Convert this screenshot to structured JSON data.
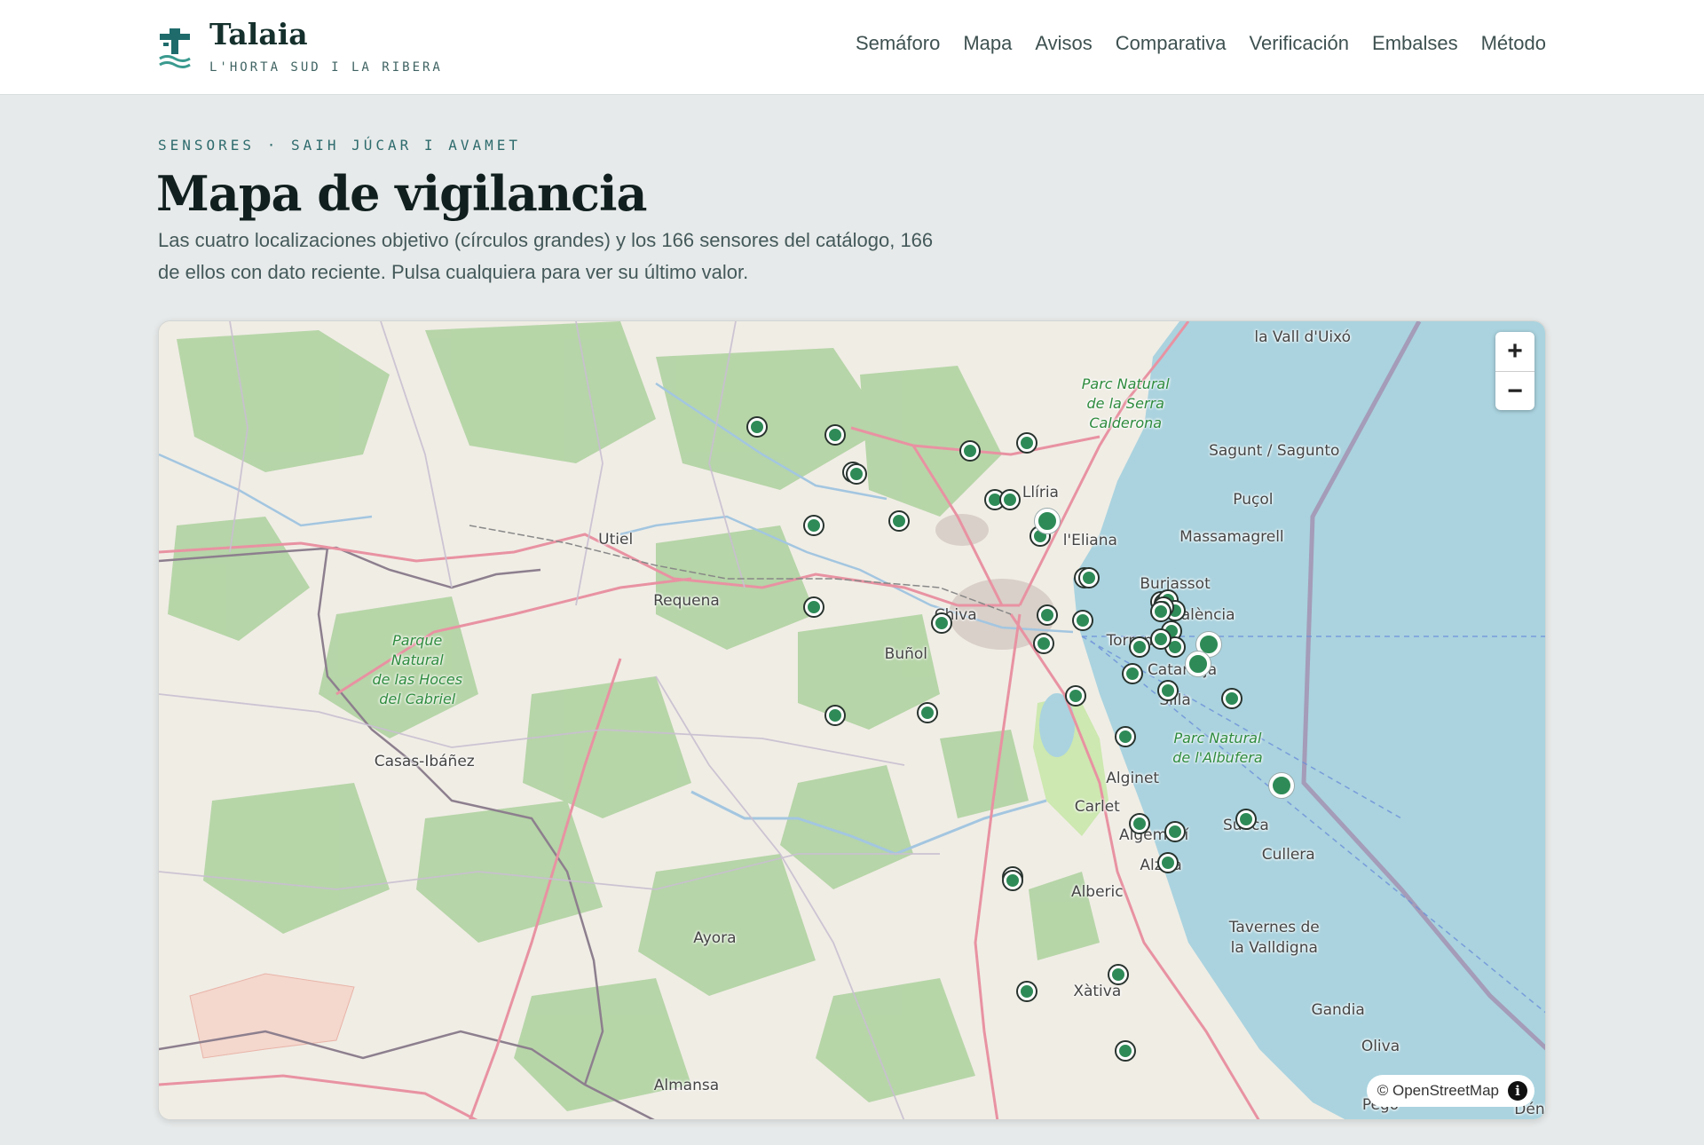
{
  "header": {
    "brand": "Talaia",
    "subtitle": "L'HORTA SUD I LA RIBERA",
    "nav": [
      "Semáforo",
      "Mapa",
      "Avisos",
      "Comparativa",
      "Verificación",
      "Embalses",
      "Método"
    ]
  },
  "intro": {
    "eyebrow": "SENSORES · SAIH JÚCAR I AVAMET",
    "title": "Mapa de vigilancia",
    "lead": "Las cuatro localizaciones objetivo (círculos grandes) y los 166 sensores del catálogo, 166 de ellos con dato reciente. Pulsa cualquiera para ver su último valor."
  },
  "map": {
    "attribution": "© OpenStreetMap",
    "zoom_in": "+",
    "zoom_out": "−",
    "colors": {
      "sensor": "#2e8b57",
      "sea": "#aad3df",
      "land": "#f0ede5",
      "forest": "#add19e"
    },
    "places": [
      {
        "name": "la Vall d'Uixó",
        "lon": -0.23,
        "lat": 39.825
      },
      {
        "name": "Sagunt / Sagunto",
        "lon": -0.27,
        "lat": 39.68
      },
      {
        "name": "Puçol",
        "lon": -0.3,
        "lat": 39.617
      },
      {
        "name": "Massamagrell",
        "lon": -0.33,
        "lat": 39.57
      },
      {
        "name": "Llíria",
        "lon": -0.6,
        "lat": 39.626
      },
      {
        "name": "l'Eliana",
        "lon": -0.53,
        "lat": 39.565
      },
      {
        "name": "Burjassot",
        "lon": -0.41,
        "lat": 39.51
      },
      {
        "name": "València",
        "lon": -0.37,
        "lat": 39.47
      },
      {
        "name": "Utiel",
        "lon": -1.2,
        "lat": 39.566
      },
      {
        "name": "Requena",
        "lon": -1.1,
        "lat": 39.488
      },
      {
        "name": "Chiva",
        "lon": -0.72,
        "lat": 39.47
      },
      {
        "name": "Buñol",
        "lon": -0.79,
        "lat": 39.42
      },
      {
        "name": "Torrent",
        "lon": -0.47,
        "lat": 39.437
      },
      {
        "name": "Catarroja",
        "lon": -0.4,
        "lat": 39.4
      },
      {
        "name": "Silla",
        "lon": -0.41,
        "lat": 39.362
      },
      {
        "name": "Casas-Ibáñez",
        "lon": -1.47,
        "lat": 39.283
      },
      {
        "name": "Alginet",
        "lon": -0.47,
        "lat": 39.262
      },
      {
        "name": "Carlet",
        "lon": -0.52,
        "lat": 39.226
      },
      {
        "name": "Algemesí",
        "lon": -0.44,
        "lat": 39.19
      },
      {
        "name": "Sueca",
        "lon": -0.31,
        "lat": 39.202
      },
      {
        "name": "Cullera",
        "lon": -0.25,
        "lat": 39.165
      },
      {
        "name": "Alzira",
        "lon": -0.43,
        "lat": 39.151
      },
      {
        "name": "Alberic",
        "lon": -0.52,
        "lat": 39.117
      },
      {
        "name": "Tavernes de",
        "lon": -0.27,
        "lat": 39.072
      },
      {
        "name": "la Valldigna",
        "lon": -0.27,
        "lat": 39.046
      },
      {
        "name": "Ayora",
        "lon": -1.06,
        "lat": 39.058
      },
      {
        "name": "Xàtiva",
        "lon": -0.52,
        "lat": 38.99
      },
      {
        "name": "Gandia",
        "lon": -0.18,
        "lat": 38.967
      },
      {
        "name": "Oliva",
        "lon": -0.12,
        "lat": 38.92
      },
      {
        "name": "Almansa",
        "lon": -1.1,
        "lat": 38.87
      },
      {
        "name": "Pego",
        "lon": -0.12,
        "lat": 38.845
      },
      {
        "name": "Dénia",
        "lon": 0.1,
        "lat": 38.84
      }
    ],
    "parks": [
      {
        "lines": [
          "Parc Natural",
          "de la Serra",
          "Calderona"
        ],
        "lon": -0.48,
        "lat": 39.74
      },
      {
        "lines": [
          "Parque",
          "Natural",
          "de las Hoces",
          "del Cabriel"
        ],
        "lon": -1.48,
        "lat": 39.4
      },
      {
        "lines": [
          "Parc Natural",
          "de l'Albufera"
        ],
        "lon": -0.35,
        "lat": 39.3
      }
    ],
    "targets": [
      {
        "lon": -0.59,
        "lat": 39.59
      },
      {
        "lon": -0.363,
        "lat": 39.433
      },
      {
        "lon": -0.377,
        "lat": 39.408
      },
      {
        "lon": -0.26,
        "lat": 39.253
      }
    ],
    "sensors": [
      {
        "lon": -1.0,
        "lat": 39.71
      },
      {
        "lon": -0.89,
        "lat": 39.7
      },
      {
        "lon": -0.7,
        "lat": 39.68
      },
      {
        "lon": -0.62,
        "lat": 39.69
      },
      {
        "lon": -0.865,
        "lat": 39.652
      },
      {
        "lon": -0.86,
        "lat": 39.65
      },
      {
        "lon": -0.665,
        "lat": 39.617
      },
      {
        "lon": -0.643,
        "lat": 39.617
      },
      {
        "lon": -0.92,
        "lat": 39.585
      },
      {
        "lon": -0.8,
        "lat": 39.59
      },
      {
        "lon": -0.6,
        "lat": 39.571
      },
      {
        "lon": -0.538,
        "lat": 39.518
      },
      {
        "lon": -0.532,
        "lat": 39.518
      },
      {
        "lon": -0.43,
        "lat": 39.487
      },
      {
        "lon": -0.425,
        "lat": 39.485
      },
      {
        "lon": -0.42,
        "lat": 39.49
      },
      {
        "lon": -0.41,
        "lat": 39.476
      },
      {
        "lon": -0.427,
        "lat": 39.48
      },
      {
        "lon": -0.43,
        "lat": 39.475
      },
      {
        "lon": -0.92,
        "lat": 39.48
      },
      {
        "lon": -0.74,
        "lat": 39.46
      },
      {
        "lon": -0.59,
        "lat": 39.47
      },
      {
        "lon": -0.54,
        "lat": 39.464
      },
      {
        "lon": -0.595,
        "lat": 39.434
      },
      {
        "lon": -0.46,
        "lat": 39.43
      },
      {
        "lon": -0.415,
        "lat": 39.45
      },
      {
        "lon": -0.41,
        "lat": 39.43
      },
      {
        "lon": -0.43,
        "lat": 39.44
      },
      {
        "lon": -0.47,
        "lat": 39.396
      },
      {
        "lon": -0.42,
        "lat": 39.374
      },
      {
        "lon": -0.55,
        "lat": 39.367
      },
      {
        "lon": -0.33,
        "lat": 39.364
      },
      {
        "lon": -0.89,
        "lat": 39.342
      },
      {
        "lon": -0.76,
        "lat": 39.346
      },
      {
        "lon": -0.48,
        "lat": 39.315
      },
      {
        "lon": -0.46,
        "lat": 39.204
      },
      {
        "lon": -0.41,
        "lat": 39.194
      },
      {
        "lon": -0.31,
        "lat": 39.21
      },
      {
        "lon": -0.42,
        "lat": 39.155
      },
      {
        "lon": -0.64,
        "lat": 39.136
      },
      {
        "lon": -0.64,
        "lat": 39.132
      },
      {
        "lon": -0.49,
        "lat": 39.012
      },
      {
        "lon": -0.62,
        "lat": 38.99
      },
      {
        "lon": -0.48,
        "lat": 38.914
      }
    ]
  }
}
